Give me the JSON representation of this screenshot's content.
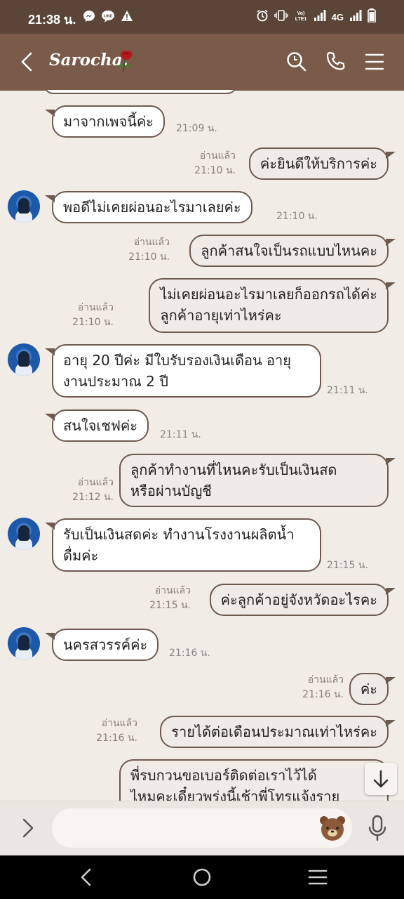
{
  "status": {
    "time": "21:38 น.",
    "network": "4G",
    "network_label": "Vo) LTE1"
  },
  "header": {
    "title": "Sarocha."
  },
  "messages": [
    {
      "text": "มาจากเพจนี้ค่ะ",
      "time": "21:09 น."
    },
    {
      "text": "ค่ะยินดีให้บริการค่ะ",
      "read": "อ่านแล้ว",
      "time": "21:10 น."
    },
    {
      "text": "พอดีไม่เคยผ่อนอะไรมาเลยค่ะ",
      "time": "21:10 น."
    },
    {
      "text": "ลูกค้าสนใจเป็นรถแบบไหนคะ",
      "read": "อ่านแล้ว",
      "time": "21:10 น."
    },
    {
      "line1": "ไม่เคยผ่อนอะไรมาเลยก็ออกรถได้ค่ะ",
      "line2": "ลูกค้าอายุเท่าไหร่คะ",
      "read": "อ่านแล้ว",
      "time": "21:10 น."
    },
    {
      "line1": "อายุ 20 ปีค่ะ มีใบรับรองเงินเดือน อายุ",
      "line2": "งานประมาณ 2 ปี",
      "time": "21:11 น."
    },
    {
      "text": "สนใจเชฟค่ะ",
      "time": "21:11 น."
    },
    {
      "line1": "ลูกค้าทำงานที่ไหนคะรับเป็นเงินสด",
      "line2": "หรือผ่านบัญชี",
      "read": "อ่านแล้ว",
      "time": "21:12 น."
    },
    {
      "line1": "รับเป็นเงินสดค่ะ ทำงานโรงงานผลิตน้ำ",
      "line2": "ดื่มค่ะ",
      "time": "21:15 น."
    },
    {
      "text": "ค่ะลูกค้าอยู่จังหวัดอะไรคะ",
      "read": "อ่านแล้ว",
      "time": "21:15 น."
    },
    {
      "text": "นครสวรรค์ค่ะ",
      "time": "21:16 น."
    },
    {
      "text": "ค่ะ",
      "read": "อ่านแล้ว",
      "time": "21:16 น."
    },
    {
      "text": "รายได้ต่อเดือนประมาณเท่าไหร่คะ",
      "read": "อ่านแล้ว",
      "time": "21:16 น."
    },
    {
      "line1": "พี่รบกวนขอเบอร์ติดต่อเราไว้ได้",
      "line2": "ไหมคะเดี๋ยวพรุ่งนี้เช้าพี่โทรแจ้งราย"
    }
  ],
  "input": {
    "placeholder": ""
  },
  "colors": {
    "header_bg": "#7a5a49",
    "status_bg": "#5a4538",
    "chat_bg": "#f1ece6",
    "bubble_border": "#6e5a4f"
  }
}
